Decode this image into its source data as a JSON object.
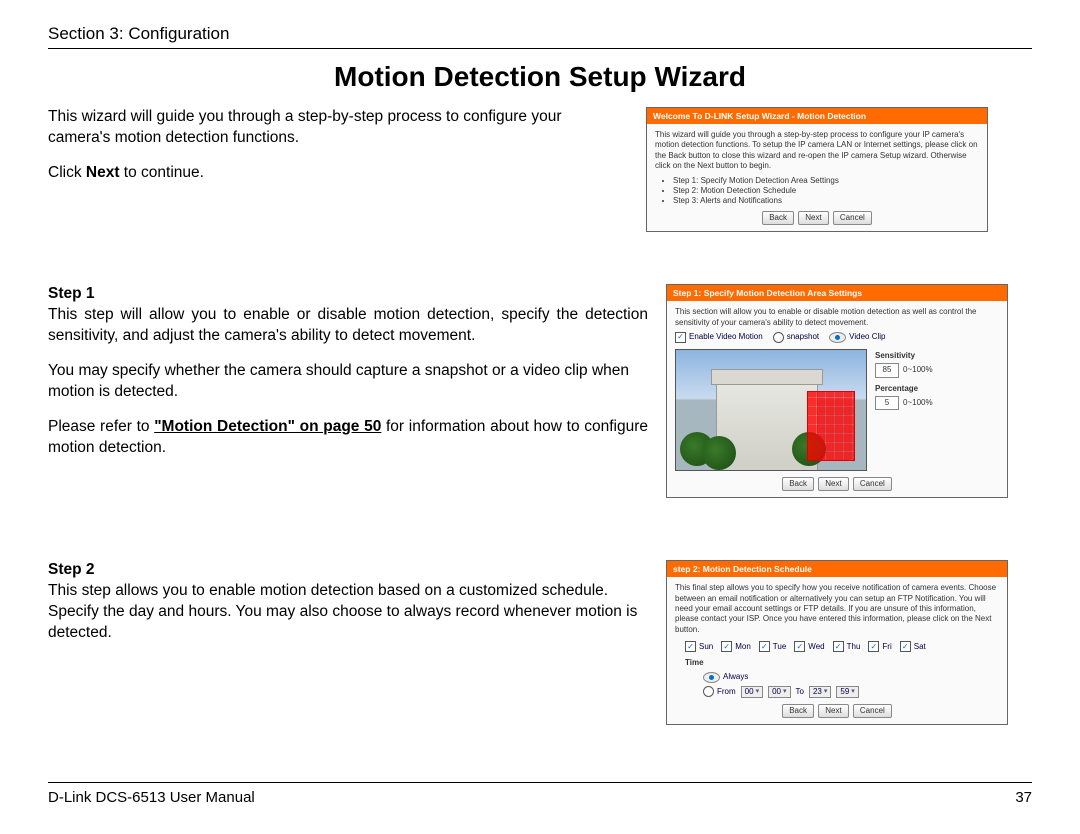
{
  "header": {
    "section": "Section 3: Configuration"
  },
  "title": "Motion Detection Setup Wizard",
  "intro": {
    "p1": "This wizard will guide you through a step-by-step process to configure your camera's motion detection functions.",
    "p2a": "Click ",
    "p2b": "Next",
    "p2c": " to continue."
  },
  "step1": {
    "label": "Step 1",
    "p1": "This step will allow you to enable or disable motion detection, specify the detection sensitivity, and adjust the camera's ability to detect movement.",
    "p2": "You may specify whether the camera should capture a snapshot or a video clip when motion is detected.",
    "p3a": "Please refer to ",
    "xref": "\"Motion Detection\" on page 50",
    "p3b": " for information about how to configure motion detection."
  },
  "step2": {
    "label": "Step 2",
    "p1": "This step allows you to enable motion detection based on a customized schedule. Specify the day and hours. You may also choose to always record whenever motion is detected."
  },
  "panel_welcome": {
    "title": "Welcome To D-LINK Setup Wizard - Motion Detection",
    "text": "This wizard will guide you through a step-by-step process to configure your IP camera's motion detection functions. To setup the IP camera LAN or Internet settings, please click on the Back button to close this wizard and re-open the IP camera Setup wizard. Otherwise click on the Next button to begin.",
    "steps": [
      "Step 1: Specify Motion Detection Area Settings",
      "Step 2: Motion Detection Schedule",
      "Step 3: Alerts and Notifications"
    ],
    "buttons": {
      "back": "Back",
      "next": "Next",
      "cancel": "Cancel"
    }
  },
  "panel_step1": {
    "title": "Step 1: Specify Motion Detection Area Settings",
    "text": "This section will allow you to enable or disable motion detection as well as control the sensitivity of your camera's ability to detect movement.",
    "enable": "Enable Video Motion",
    "snapshot": "snapshot",
    "videoclip": "Video Clip",
    "sensitivity_label": "Sensitivity",
    "sensitivity_value": "85",
    "sensitivity_range": "0~100%",
    "percentage_label": "Percentage",
    "percentage_value": "5",
    "percentage_range": "0~100%",
    "buttons": {
      "back": "Back",
      "next": "Next",
      "cancel": "Cancel"
    }
  },
  "panel_step2": {
    "title": "step 2: Motion Detection Schedule",
    "text": "This final step allows you to specify how you receive notification of camera events. Choose between an email notification or alternatively you can setup an FTP Notification. You will need your email account settings or FTP details. If you are unsure of this information, please contact your ISP. Once you have entered this information, please click on the Next button.",
    "days": [
      "Sun",
      "Mon",
      "Tue",
      "Wed",
      "Thu",
      "Fri",
      "Sat"
    ],
    "time_label": "Time",
    "always": "Always",
    "from": "From",
    "to": "To",
    "h1": "00",
    "m1": "00",
    "h2": "23",
    "m2": "59",
    "buttons": {
      "back": "Back",
      "next": "Next",
      "cancel": "Cancel"
    }
  },
  "footer": {
    "left": "D-Link DCS-6513 User Manual",
    "right": "37"
  }
}
